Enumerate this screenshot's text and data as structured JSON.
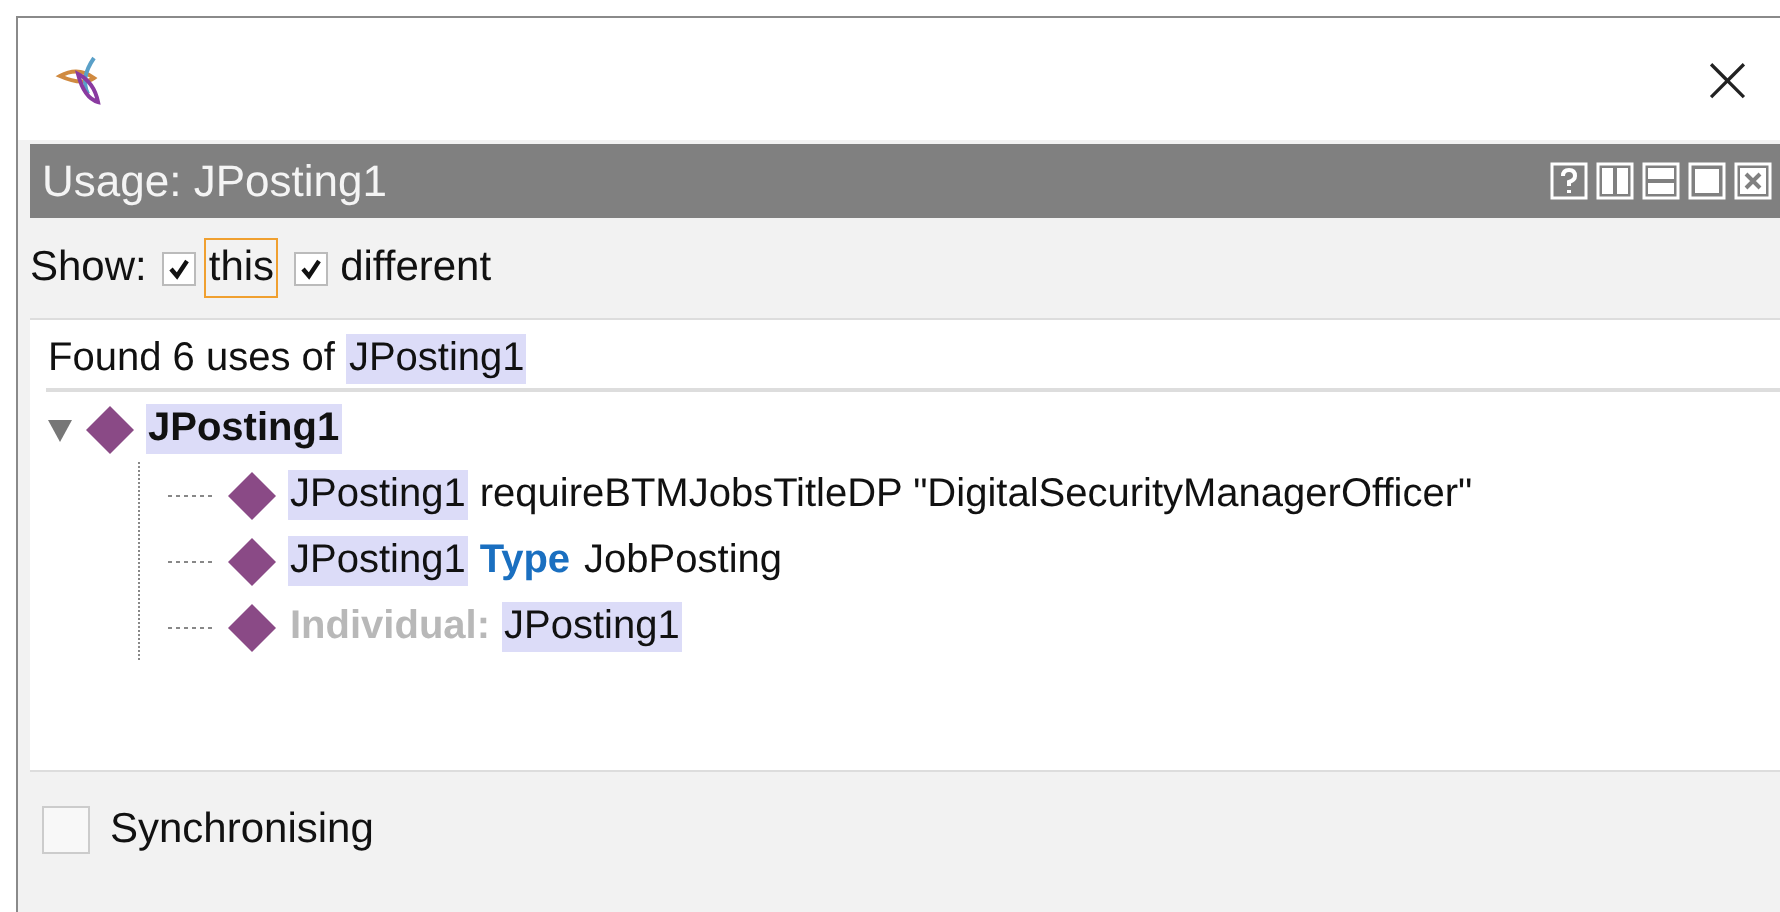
{
  "window": {
    "close": "×"
  },
  "panel": {
    "title": "Usage: JPosting1"
  },
  "show": {
    "label": "Show:",
    "options": [
      {
        "label": "this",
        "checked": true,
        "focused": true
      },
      {
        "label": "different",
        "checked": true,
        "focused": false
      }
    ]
  },
  "results": {
    "summary": [
      {
        "kind": "text",
        "text": "Found 6 uses of"
      },
      {
        "kind": "entity",
        "text": "JPosting1"
      }
    ],
    "tree": [
      {
        "expanded": true,
        "segments": [
          {
            "kind": "entity",
            "text": "JPosting1"
          }
        ],
        "children": [
          {
            "segments": [
              {
                "kind": "entity",
                "text": "JPosting1"
              },
              {
                "kind": "text",
                "text": "requireBTMJobsTitleDP \"DigitalSecurityManagerOfficer\""
              }
            ]
          },
          {
            "segments": [
              {
                "kind": "entity",
                "text": "JPosting1"
              },
              {
                "kind": "keyword",
                "text": "Type"
              },
              {
                "kind": "text",
                "text": "JobPosting"
              }
            ]
          },
          {
            "segments": [
              {
                "kind": "label",
                "text": "Individual:"
              },
              {
                "kind": "entity",
                "text": "JPosting1"
              }
            ]
          }
        ]
      }
    ]
  },
  "sync": {
    "label": "Synchronising",
    "checked": false
  }
}
